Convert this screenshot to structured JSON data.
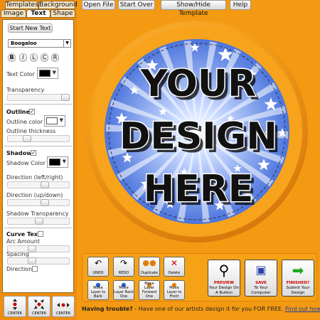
{
  "tabs": [
    "Templates",
    "Background",
    "Image",
    "Text",
    "Shape"
  ],
  "toolbar": [
    "Open File",
    "Start Over",
    "Show/Hide Template",
    "Help"
  ],
  "text_panel": {
    "start_new_text": "Start New Text",
    "font": "Boogaloo",
    "style_buttons": [
      "B",
      "I",
      "L",
      "C",
      "R"
    ],
    "text_color_label": "Text Color",
    "text_color": "#000000",
    "transparency_label": "Transparency",
    "outline_label": "Outline",
    "outline_checked": true,
    "outline_color_label": "Outline color",
    "outline_color": "#ffffff",
    "outline_thickness_label": "Outline thickness",
    "shadow_label": "Shadow",
    "shadow_checked": true,
    "shadow_color_label": "Shadow Color",
    "shadow_color": "#000000",
    "direction_lr_label": "Direction (left/right)",
    "direction_ud_label": "Direction (up/down)",
    "shadow_transparency_label": "Shadow Transparency",
    "curve_text_label": "Curve Text",
    "curve_checked": false,
    "arc_amount_label": "Arc Amount",
    "spacing_label": "Spacing",
    "direction_label": "Direction",
    "direction_checked": false
  },
  "center_buttons": [
    "CENTER",
    "CENTER",
    "CENTER"
  ],
  "design": {
    "line1": "YOUR",
    "line2": "DESIGN",
    "line3": "HERE"
  },
  "tools": {
    "undo": "UNDO",
    "redo": "REDO",
    "duplicate": "Duplicate",
    "delete": "Delete",
    "move_back": "Move Layer to Back",
    "move_back_one": "Move Layer Back One",
    "move_forward_one": "Move Layer Forward One",
    "move_front": "Move Layer to Front",
    "preview_title": "PREVIEW",
    "preview_sub": "Your Design On A Button",
    "save_title": "SAVE",
    "save_sub": "To Your Computer",
    "finished_title": "FINISHED?",
    "finished_sub": "Submit Your Design"
  },
  "footer": {
    "lead": "Having trouble?",
    "text": " - Have one of our artists design it for you FOR FREE. ",
    "link": "Find out how"
  },
  "colors": {
    "background": "#f39a12",
    "badge_blue": "#5b86e6",
    "rim": "#f6a21c"
  }
}
